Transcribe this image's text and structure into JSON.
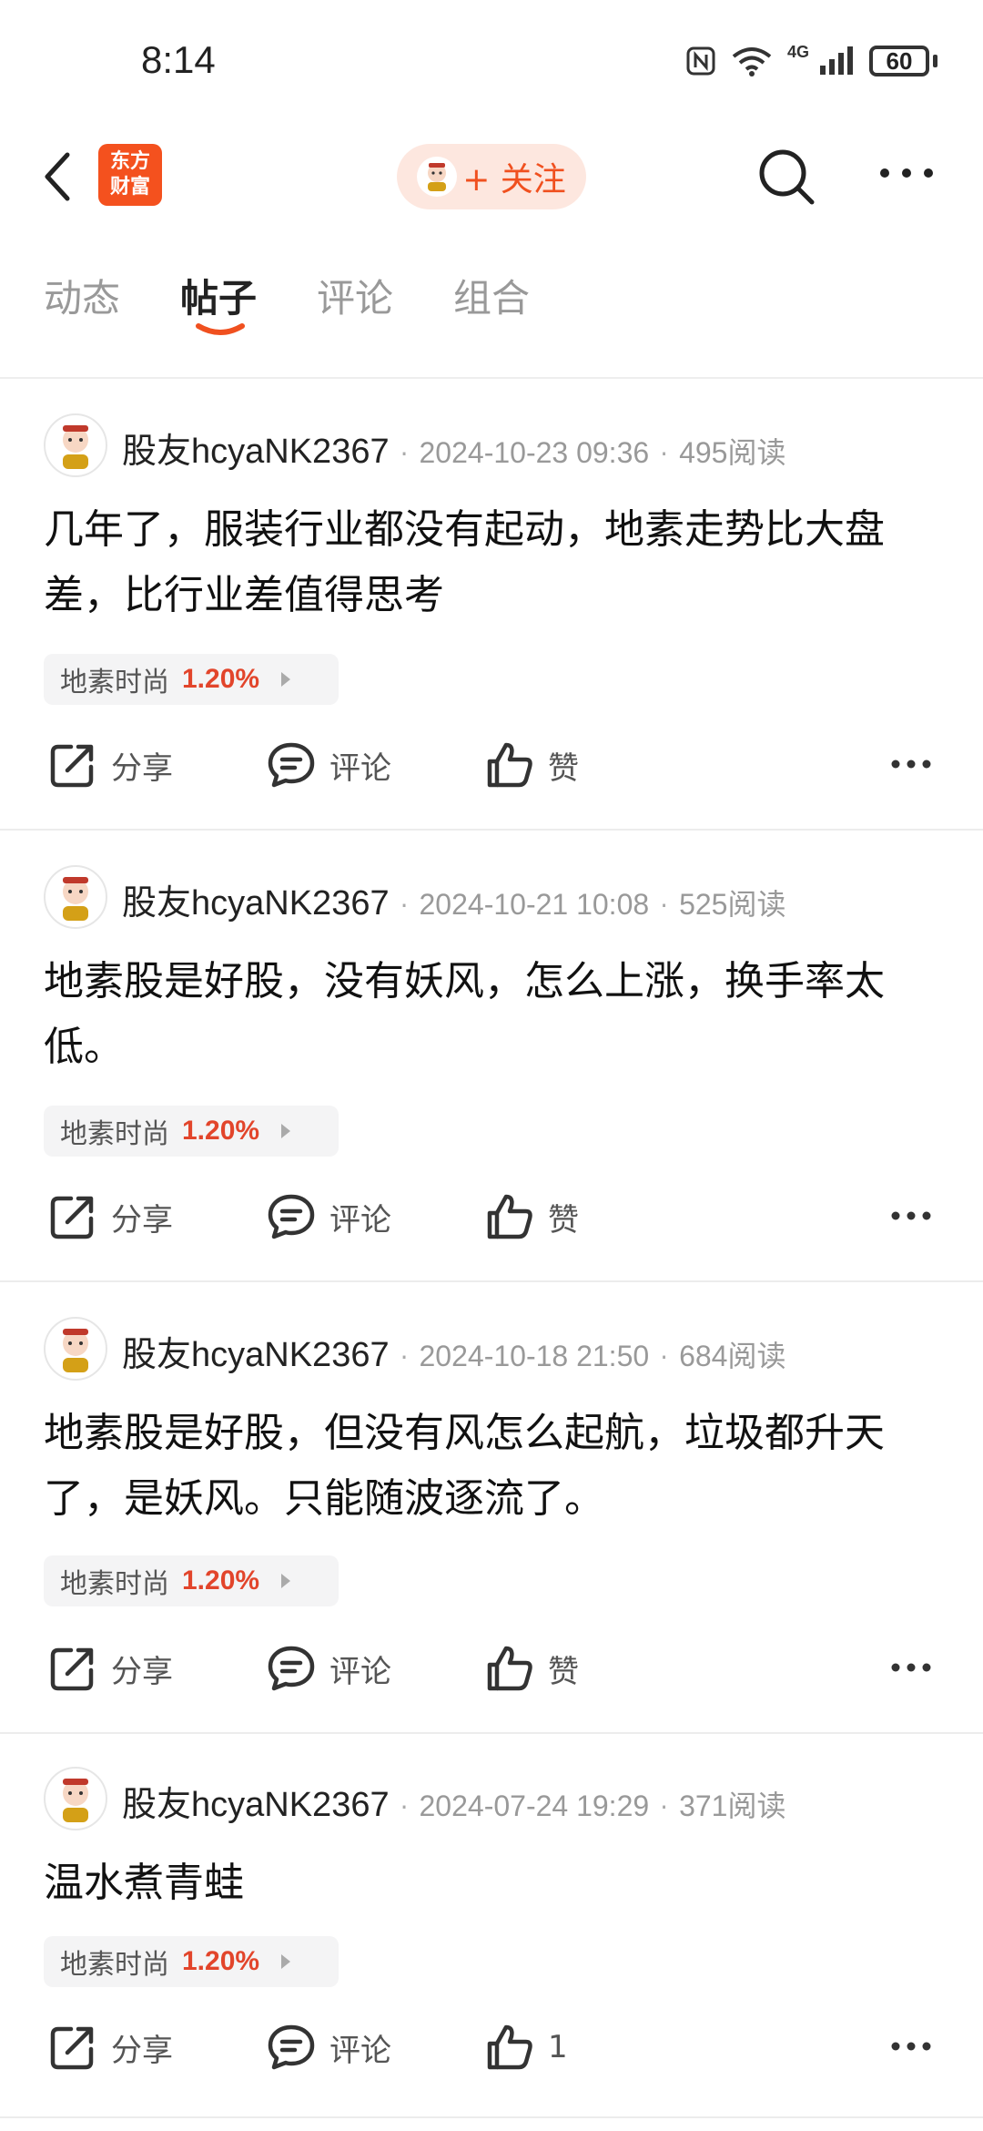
{
  "status_bar": {
    "time": "8:14",
    "network": "4G",
    "battery": "60"
  },
  "header": {
    "brand_logo_text": "东方财富",
    "follow_label": "+ 关注",
    "accent_color": "#f0501f"
  },
  "tabs": [
    {
      "label": "动态",
      "active": false
    },
    {
      "label": "帖子",
      "active": true
    },
    {
      "label": "评论",
      "active": false
    },
    {
      "label": "组合",
      "active": false
    }
  ],
  "posts": [
    {
      "author": "股友hcyaNK2367",
      "time": "2024-10-23 09:36",
      "reads": "495阅读",
      "content": "几年了，服装行业都没有起动，地素走势比大盘差，比行业差值得思考",
      "stock_name": "地素时尚",
      "stock_change": "1.20%",
      "share_label": "分享",
      "comment_label": "评论",
      "like_label": "赞"
    },
    {
      "author": "股友hcyaNK2367",
      "time": "2024-10-21 10:08",
      "reads": "525阅读",
      "content": "地素股是好股，没有妖风，怎么上涨，换手率太低。",
      "stock_name": "地素时尚",
      "stock_change": "1.20%",
      "share_label": "分享",
      "comment_label": "评论",
      "like_label": "赞"
    },
    {
      "author": "股友hcyaNK2367",
      "time": "2024-10-18 21:50",
      "reads": "684阅读",
      "content": "地素股是好股，但没有风怎么起航，垃圾都升天了，是妖风。只能随波逐流了。",
      "stock_name": "地素时尚",
      "stock_change": "1.20%",
      "share_label": "分享",
      "comment_label": "评论",
      "like_label": "赞"
    },
    {
      "author": "股友hcyaNK2367",
      "time": "2024-07-24 19:29",
      "reads": "371阅读",
      "content": "温水煮青蛙",
      "stock_name": "地素时尚",
      "stock_change": "1.20%",
      "share_label": "分享",
      "comment_label": "评论",
      "like_label": "1"
    }
  ]
}
